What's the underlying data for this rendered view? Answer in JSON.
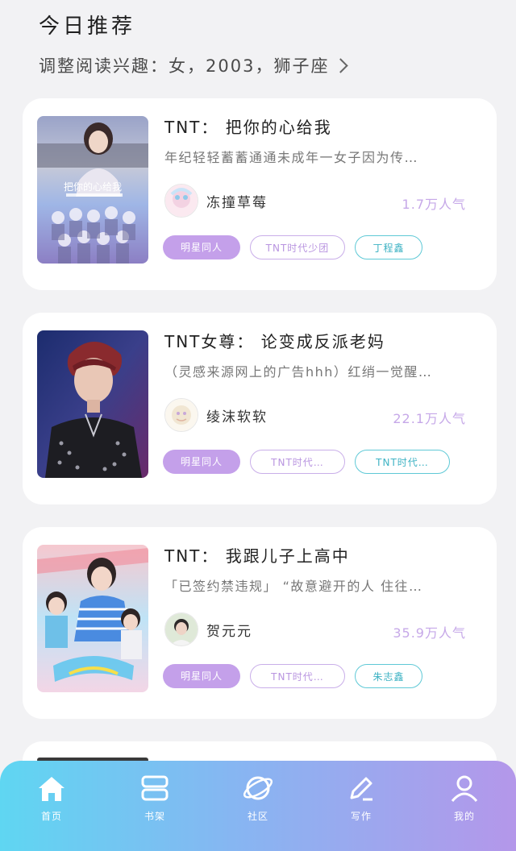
{
  "header": {
    "title": "今日推荐",
    "interest_label": "调整阅读兴趣：女，2003，狮子座"
  },
  "books": [
    {
      "title": "TNT： 把你的心给我",
      "description": "年纪轻轻蓄蓄通通未成年一女子因为传…",
      "author": "冻撞草莓",
      "popularity": "1.7万人气",
      "cover_text": "把你的心给我",
      "tags": [
        {
          "label": "明星同人",
          "style": "fill"
        },
        {
          "label": "TNT时代少团",
          "style": "outline"
        },
        {
          "label": "丁程鑫",
          "style": "teal"
        }
      ]
    },
    {
      "title": "TNT女尊： 论变成反派老妈",
      "description": "（灵感来源网上的广告hhh）红绡一觉醒…",
      "author": "绫沫软软",
      "popularity": "22.1万人气",
      "tags": [
        {
          "label": "明星同人",
          "style": "fill"
        },
        {
          "label": "TNT时代…",
          "style": "outline"
        },
        {
          "label": "TNT时代…",
          "style": "teal"
        }
      ]
    },
    {
      "title": "TNT： 我跟儿子上高中",
      "description": "「已签约禁违规」 “故意避开的人 住往…",
      "author": "贺元元",
      "popularity": "35.9万人气",
      "tags": [
        {
          "label": "明星同人",
          "style": "fill"
        },
        {
          "label": "TNT时代…",
          "style": "outline"
        },
        {
          "label": "朱志鑫",
          "style": "teal"
        }
      ]
    }
  ],
  "tabbar": [
    {
      "label": "首页",
      "icon": "home-icon",
      "active": true
    },
    {
      "label": "书架",
      "icon": "bookshelf-icon"
    },
    {
      "label": "社区",
      "icon": "planet-icon"
    },
    {
      "label": "写作",
      "icon": "pen-icon"
    },
    {
      "label": "我的",
      "icon": "user-icon"
    }
  ],
  "colors": {
    "accent_purple": "#c4a0ea",
    "teal": "#5fc9d6",
    "tabbar_start": "#5fd6f2",
    "tabbar_end": "#b497ea"
  }
}
